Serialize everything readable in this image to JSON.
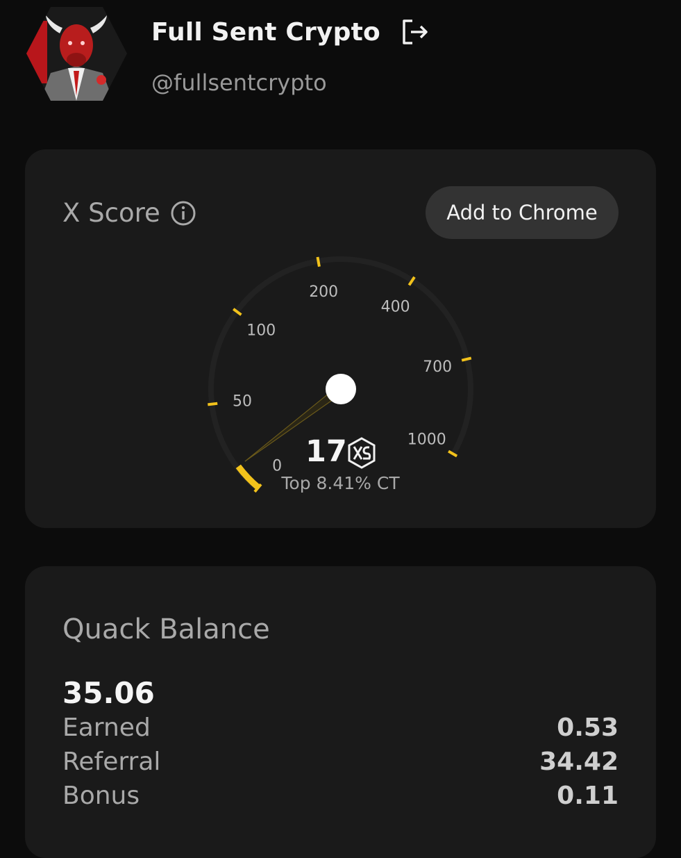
{
  "profile": {
    "display_name": "Full Sent Crypto",
    "handle": "@fullsentcrypto",
    "avatar_icon": "bull-in-suit-avatar",
    "logout_icon": "logout-icon"
  },
  "score_card": {
    "title": "X Score",
    "info_icon": "info-icon",
    "add_button_label": "Add to Chrome",
    "gauge_labels": [
      "0",
      "50",
      "100",
      "200",
      "400",
      "700",
      "1000"
    ],
    "score": "17",
    "score_fraction_of_gauge": 0.05,
    "rank_text": "Top 8.41% CT",
    "accent_color": "#f2c21b"
  },
  "balance_card": {
    "title": "Quack Balance",
    "total": "35.06",
    "rows": [
      {
        "label": "Earned",
        "value": "0.53"
      },
      {
        "label": "Referral",
        "value": "34.42"
      },
      {
        "label": "Bonus",
        "value": "0.11"
      }
    ]
  }
}
